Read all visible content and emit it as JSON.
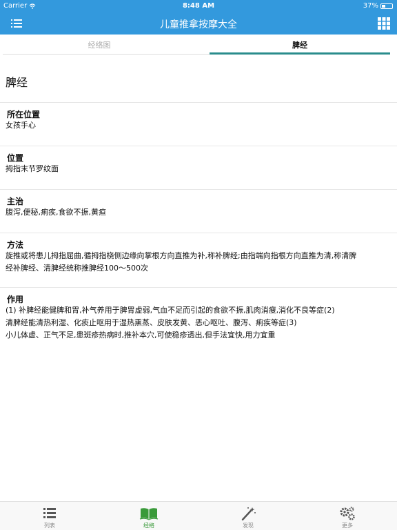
{
  "status": {
    "carrier": "Carrier",
    "time": "8:48 AM",
    "battery": "37%",
    "battery_level": 0.37
  },
  "nav": {
    "title": "儿童推拿按摩大全",
    "menu_icon": "list-icon",
    "grid_icon": "grid-icon"
  },
  "tabs": [
    {
      "label": "经络图"
    },
    {
      "label": "脾经"
    }
  ],
  "detail": {
    "title": "脾经",
    "sections": [
      {
        "heading": "所在位置",
        "lines": [
          "女孩手心"
        ]
      },
      {
        "heading": "位置",
        "lines": [
          "拇指末节罗纹面"
        ]
      },
      {
        "heading": "主治",
        "lines": [
          "腹泻,便秘,痢疾,食欲不振,黄疸"
        ]
      },
      {
        "heading": "方法",
        "lines": [
          "旋推或将患儿拇指屈曲,循拇指桡侧边缘向掌根方向直推为补,称补脾经;由指端向指根方向直推为清,称清脾",
          "经补脾经、清脾经统称推脾经100～500次"
        ]
      },
      {
        "heading": "作用",
        "lines": [
          "(1) 补脾经能健脾和胃,补气养用于脾胃虚弱,气血不足而引起的食欲不振,肌肉消瘦,消化不良等症(2)",
          "清脾经能清热利湿、化痰止呕用于湿热熏蒸、皮肤发黄、恶心呕吐、腹泻、痢疾等症(3)",
          "小儿体虚、正气不足,患斑疹热病时,推补本穴,可使稳疹透出,但手法宜快,用力宜重"
        ]
      }
    ]
  },
  "tabbar": [
    {
      "label": "列表",
      "icon": "list-icon"
    },
    {
      "label": "经络",
      "icon": "book-icon"
    },
    {
      "label": "发现",
      "icon": "magic-wand-icon"
    },
    {
      "label": "更多",
      "icon": "gears-icon"
    }
  ],
  "colors": {
    "primary": "#3399dd",
    "tab_indicator": "#2a8c8c",
    "active_tab": "#3a9a3a"
  }
}
